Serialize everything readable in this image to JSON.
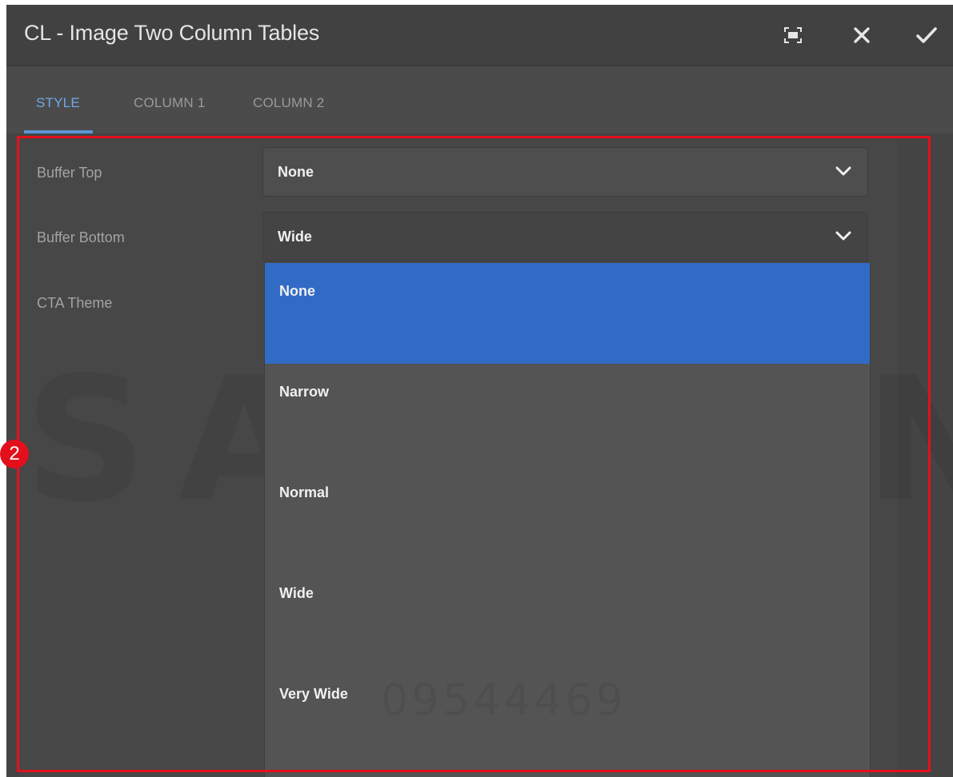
{
  "dialog": {
    "title": "CL - Image Two Column Tables",
    "toolbar": {
      "fullscreen_icon": "fullscreen-icon",
      "close_icon": "close-icon",
      "confirm_icon": "checkmark-icon"
    }
  },
  "tabs": [
    {
      "label": "STYLE",
      "active": true
    },
    {
      "label": "COLUMN 1",
      "active": false
    },
    {
      "label": "COLUMN 2",
      "active": false
    }
  ],
  "fields": {
    "buffer_top": {
      "label": "Buffer Top",
      "value": "None"
    },
    "buffer_bottom": {
      "label": "Buffer Bottom",
      "value": "Wide"
    },
    "cta_theme": {
      "label": "CTA Theme"
    }
  },
  "dropdown": {
    "options": [
      "None",
      "Narrow",
      "Normal",
      "Wide",
      "Very Wide"
    ],
    "highlighted": "None"
  },
  "watermark": {
    "brand": "SAMSUNG",
    "number": "09544469"
  },
  "annotation": {
    "step_number": "2",
    "color": "#e3101b"
  },
  "colors": {
    "accent": "#326bc6",
    "tab_active": "#6fa9e6",
    "background": "#4b4b4b"
  }
}
